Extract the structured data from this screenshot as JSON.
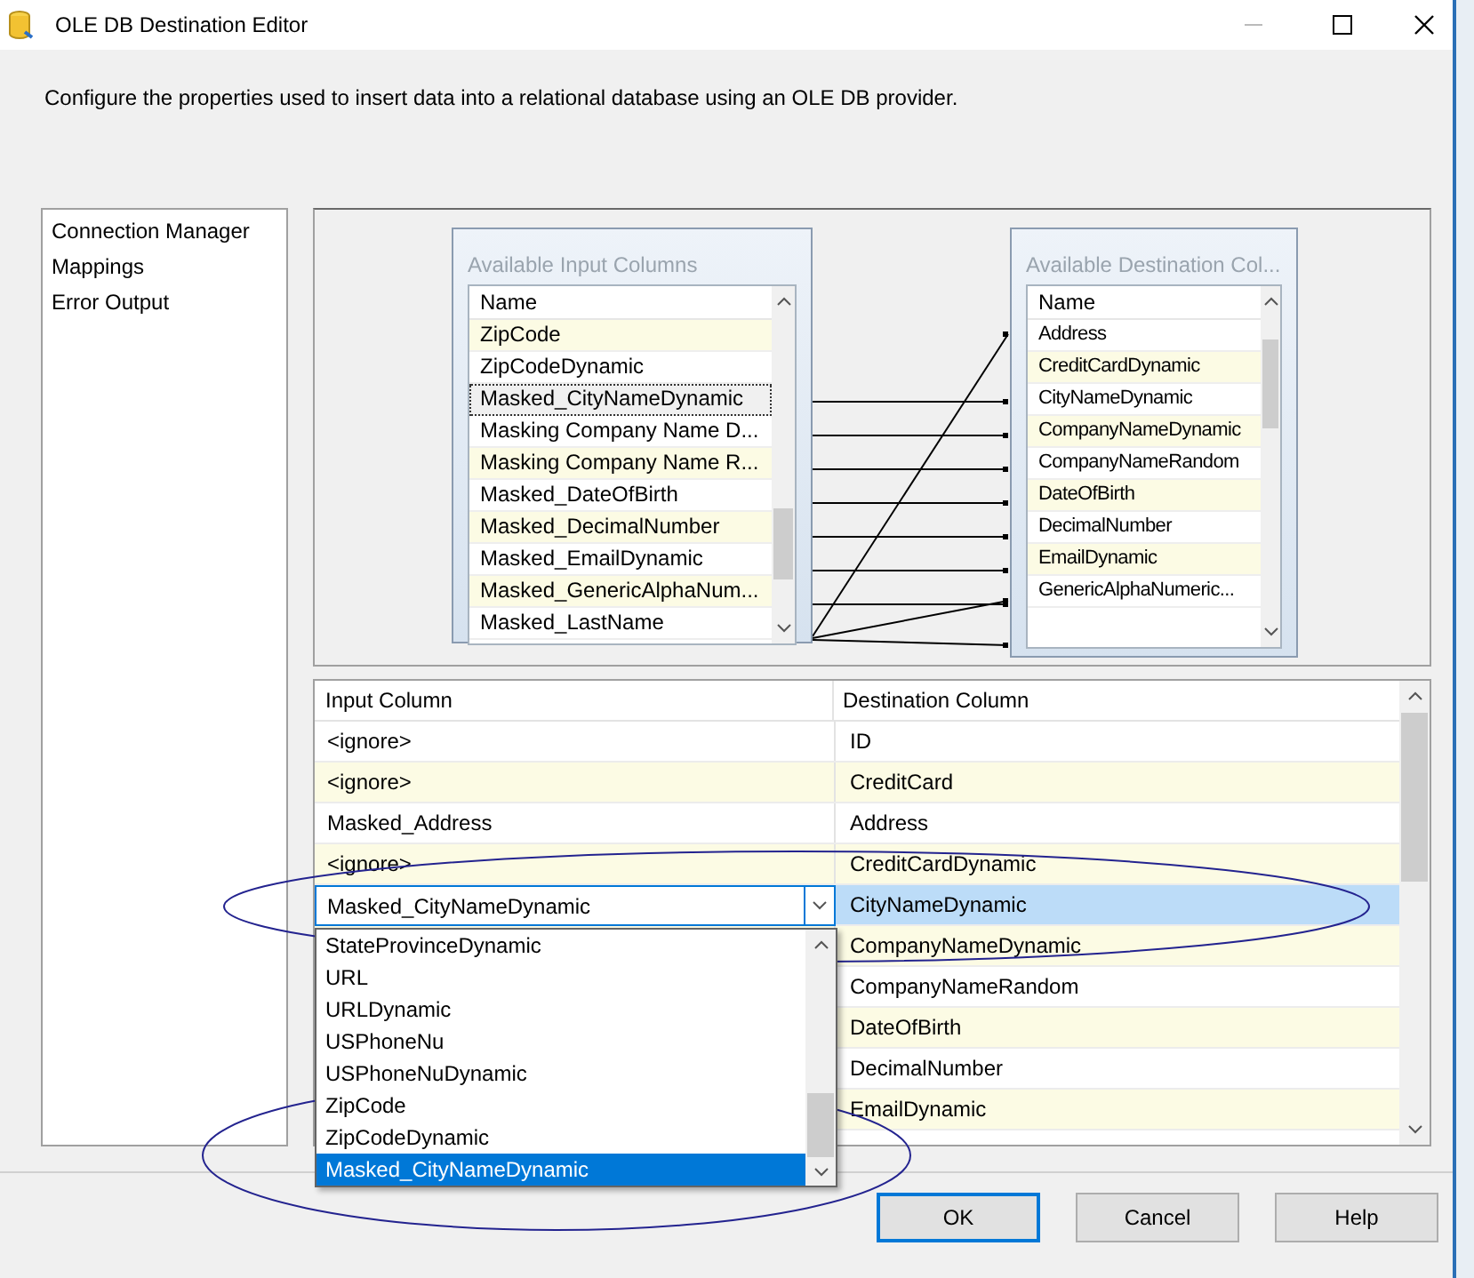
{
  "window": {
    "title": "OLE DB Destination Editor"
  },
  "description": "Configure the properties used to insert data into a relational database using an OLE DB provider.",
  "sidebar": {
    "items": [
      {
        "label": "Connection Manager"
      },
      {
        "label": "Mappings"
      },
      {
        "label": "Error Output"
      }
    ]
  },
  "input_columns": {
    "title": "Available Input Columns",
    "header": "Name",
    "items": [
      {
        "label": "ZipCode",
        "focused": false
      },
      {
        "label": "ZipCodeDynamic",
        "focused": false
      },
      {
        "label": "Masked_CityNameDynamic",
        "focused": true
      },
      {
        "label": "Masking Company Name D...",
        "focused": false
      },
      {
        "label": "Masking Company Name R...",
        "focused": false
      },
      {
        "label": "Masked_DateOfBirth",
        "focused": false
      },
      {
        "label": "Masked_DecimalNumber",
        "focused": false
      },
      {
        "label": "Masked_EmailDynamic",
        "focused": false
      },
      {
        "label": "Masked_GenericAlphaNum...",
        "focused": false
      },
      {
        "label": "Masked_LastName",
        "focused": false
      }
    ]
  },
  "destination_columns": {
    "title": "Available Destination Col...",
    "header": "Name",
    "items": [
      {
        "label": "Address"
      },
      {
        "label": "CreditCardDynamic"
      },
      {
        "label": "CityNameDynamic"
      },
      {
        "label": "CompanyNameDynamic"
      },
      {
        "label": "CompanyNameRandom"
      },
      {
        "label": "DateOfBirth"
      },
      {
        "label": "DecimalNumber"
      },
      {
        "label": "EmailDynamic"
      },
      {
        "label": "GenericAlphaNumeric..."
      }
    ]
  },
  "table": {
    "columns": [
      "Input Column",
      "Destination Column"
    ],
    "rows": [
      {
        "input": "<ignore>",
        "destination": "ID",
        "selected": false
      },
      {
        "input": "<ignore>",
        "destination": "CreditCard",
        "selected": false
      },
      {
        "input": "Masked_Address",
        "destination": "Address",
        "selected": false
      },
      {
        "input": "<ignore>",
        "destination": "CreditCardDynamic",
        "selected": false
      },
      {
        "input": "Masked_CityNameDynamic",
        "destination": "CityNameDynamic",
        "selected": true
      },
      {
        "destination": "CompanyNameDynamic",
        "selected": false
      },
      {
        "destination": "CompanyNameRandom",
        "selected": false
      },
      {
        "destination": "DateOfBirth",
        "selected": false
      },
      {
        "destination": "DecimalNumber",
        "selected": false
      },
      {
        "destination": "EmailDynamic",
        "selected": false
      }
    ]
  },
  "dropdown": {
    "items": [
      {
        "label": "StateProvinceDynamic",
        "selected": false
      },
      {
        "label": "URL",
        "selected": false
      },
      {
        "label": "URLDynamic",
        "selected": false
      },
      {
        "label": "USPhoneNu",
        "selected": false
      },
      {
        "label": "USPhoneNuDynamic",
        "selected": false
      },
      {
        "label": "ZipCode",
        "selected": false
      },
      {
        "label": "ZipCodeDynamic",
        "selected": false
      },
      {
        "label": "Masked_CityNameDynamic",
        "selected": true
      }
    ]
  },
  "buttons": [
    {
      "label": "OK",
      "default": true
    },
    {
      "label": "Cancel",
      "default": false
    },
    {
      "label": "Help",
      "default": false
    }
  ]
}
